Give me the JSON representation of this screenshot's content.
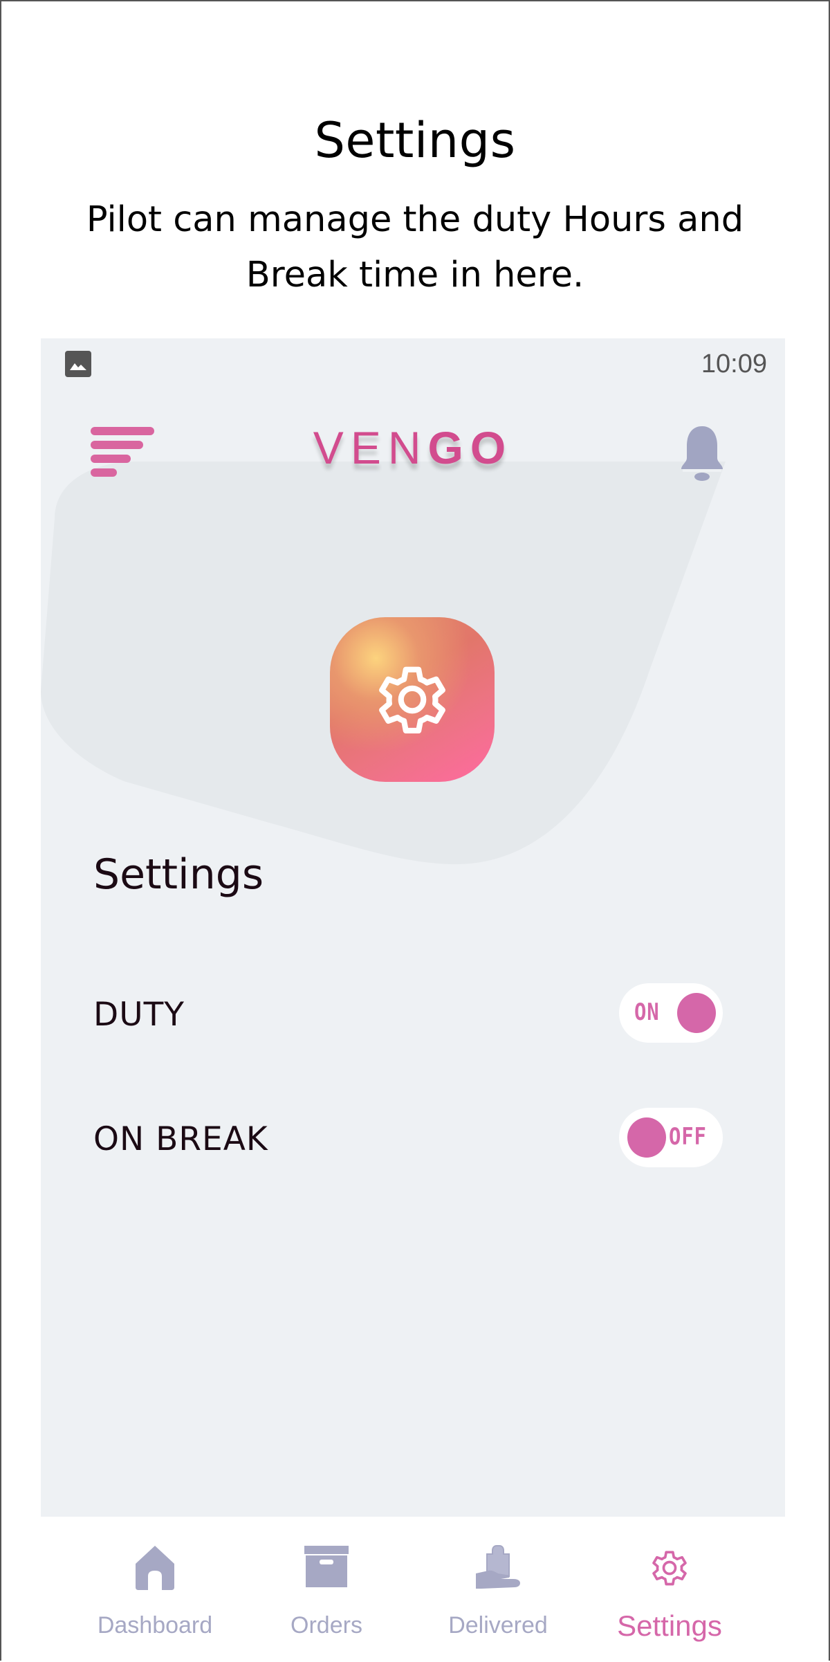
{
  "caption": {
    "title": "Settings",
    "description": "Pilot can manage the duty Hours and Break time in here."
  },
  "status_bar": {
    "left_icon": "image-icon",
    "time": "10:09"
  },
  "app_bar": {
    "menu_icon": "menu-icon",
    "logo_light": "VEN",
    "logo_bold": "GO",
    "notification_icon": "bell-icon"
  },
  "hero": {
    "icon": "gear-icon"
  },
  "settings": {
    "title": "Settings",
    "items": [
      {
        "label": "DUTY",
        "toggle_text": "ON",
        "state": "on"
      },
      {
        "label": "ON BREAK",
        "toggle_text": "OFF",
        "state": "off"
      }
    ]
  },
  "bottom_nav": {
    "items": [
      {
        "label": "Dashboard",
        "icon": "home-icon",
        "active": false
      },
      {
        "label": "Orders",
        "icon": "box-icon",
        "active": false
      },
      {
        "label": "Delivered",
        "icon": "hand-bag-icon",
        "active": false
      },
      {
        "label": "Settings",
        "icon": "gear-icon",
        "active": true
      }
    ]
  },
  "colors": {
    "accent": "#d567a9",
    "logo": "#d24c8e",
    "inactive_nav": "#a6a8c4",
    "background": "#eef1f4"
  }
}
